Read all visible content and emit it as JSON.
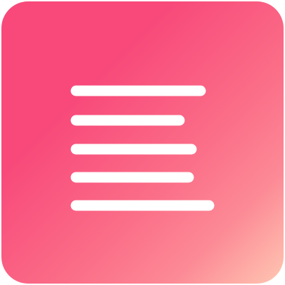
{
  "app_icon": {
    "icon": "text-lines-icon",
    "colors": {
      "gradient_start": "#f8497a",
      "gradient_mid": "#fb6f88",
      "gradient_end": "#ffc7b2",
      "lines": "#ffffff"
    }
  }
}
